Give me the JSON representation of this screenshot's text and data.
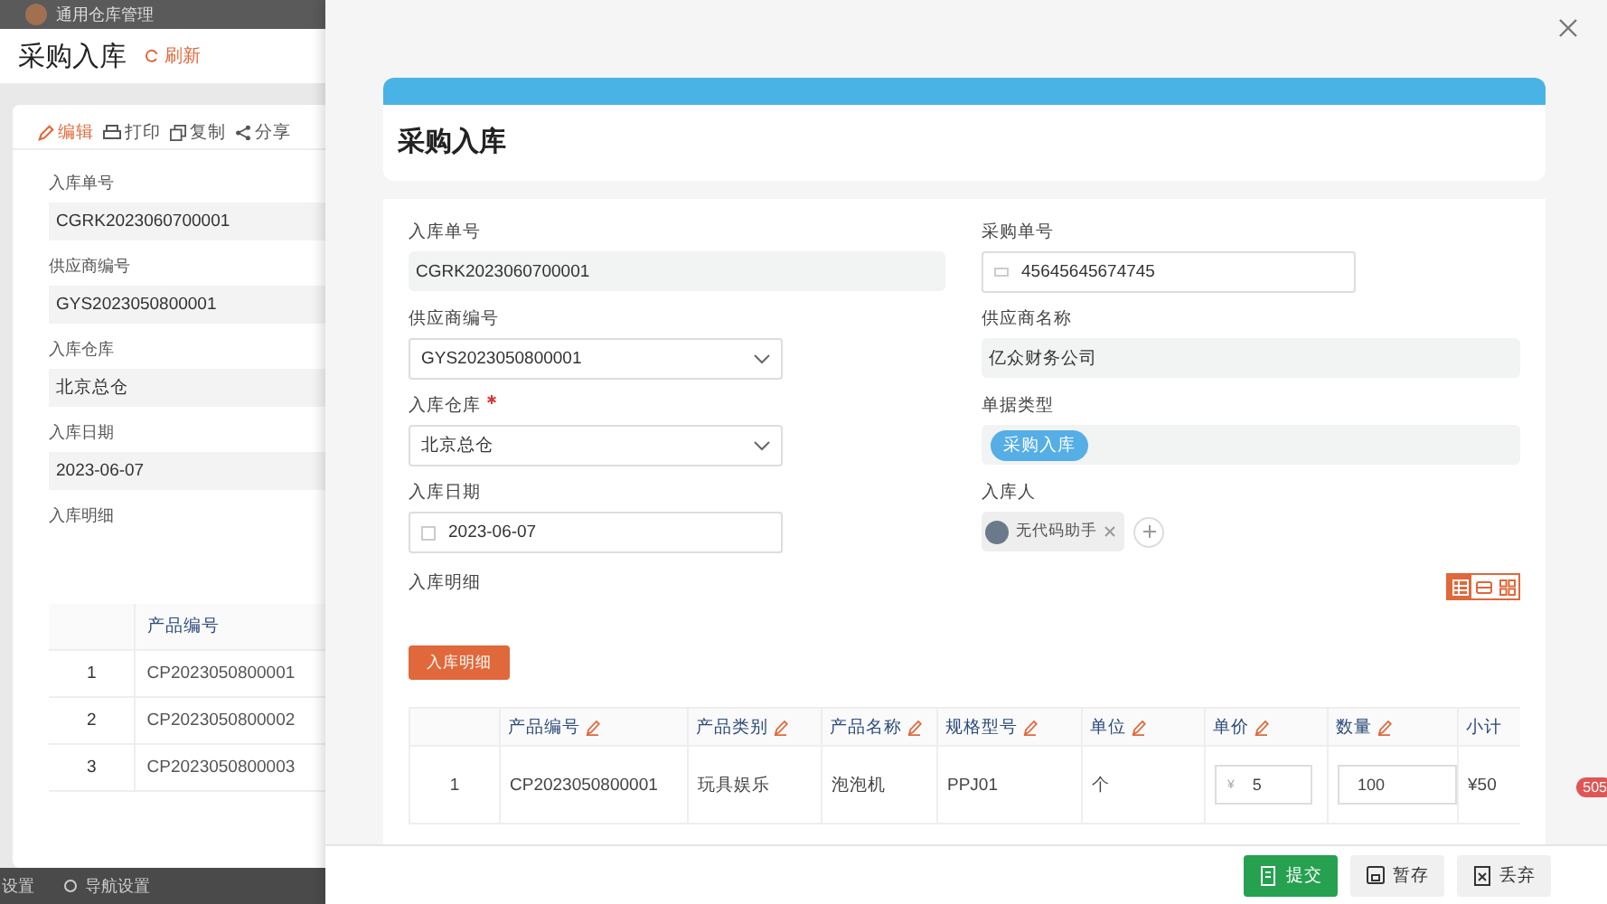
{
  "background_page": {
    "app_name": "通用仓库管理",
    "title": "采购入库",
    "refresh": "刷新",
    "toolbar": [
      {
        "label": "编辑",
        "kind": "edit",
        "primary": true
      },
      {
        "label": "打印",
        "kind": "print",
        "primary": false
      },
      {
        "label": "复制",
        "kind": "copy",
        "primary": false
      },
      {
        "label": "分享",
        "kind": "share",
        "primary": false
      }
    ],
    "fields": [
      {
        "label": "入库单号",
        "value": "CGRK2023060700001"
      },
      {
        "label": "供应商编号",
        "value": "GYS2023050800001"
      },
      {
        "label": "入库仓库",
        "value": "北京总仓"
      },
      {
        "label": "入库日期",
        "value": "2023-06-07"
      }
    ],
    "detail_label": "入库明细",
    "table": {
      "columns": [
        "",
        "产品编号"
      ],
      "rows": [
        [
          "1",
          "CP2023050800001"
        ],
        [
          "2",
          "CP2023050800002"
        ],
        [
          "3",
          "CP2023050800003"
        ]
      ]
    },
    "bottom_bar": [
      "设置",
      "导航设置"
    ]
  },
  "drawer": {
    "title": "采购入库",
    "fields": [
      {
        "label": "入库单号",
        "kind": "readonly",
        "value": "CGRK2023060700001",
        "required": false
      },
      {
        "label": "采购单号",
        "kind": "input",
        "value": "45645645674745",
        "required": false
      },
      {
        "label": "供应商编号",
        "kind": "select",
        "value": "GYS2023050800001",
        "required": false
      },
      {
        "label": "供应商名称",
        "kind": "readonly",
        "value": "亿众财务公司",
        "required": false
      },
      {
        "label": "入库仓库",
        "kind": "select",
        "value": "北京总仓",
        "required": true
      },
      {
        "label": "单据类型",
        "kind": "tag",
        "value": "采购入库",
        "required": false
      },
      {
        "label": "入库日期",
        "kind": "date",
        "value": "2023-06-07",
        "required": false
      },
      {
        "label": "入库人",
        "kind": "user",
        "value": "无代码助手",
        "required": false
      }
    ],
    "detail_label": "入库明细",
    "view_modes": [
      {
        "kind": "table",
        "selected": true
      },
      {
        "kind": "card",
        "selected": false
      },
      {
        "kind": "grid",
        "selected": false
      }
    ],
    "detail_button": "入库明细",
    "table": {
      "columns": [
        {
          "label": "产品编号",
          "editable": true
        },
        {
          "label": "产品类别",
          "editable": true
        },
        {
          "label": "产品名称",
          "editable": true
        },
        {
          "label": "规格型号",
          "editable": true
        },
        {
          "label": "单位",
          "editable": true
        },
        {
          "label": "单价",
          "editable": true
        },
        {
          "label": "数量",
          "editable": true
        },
        {
          "label": "小计",
          "editable": false
        }
      ],
      "rows": [
        {
          "index": "1",
          "cells": [
            {
              "kind": "text",
              "value": "CP2023050800001"
            },
            {
              "kind": "text",
              "value": "玩具娱乐"
            },
            {
              "kind": "text",
              "value": "泡泡机"
            },
            {
              "kind": "text",
              "value": "PPJ01"
            },
            {
              "kind": "text",
              "value": "个"
            },
            {
              "kind": "price",
              "prefix": "¥",
              "value": "5"
            },
            {
              "kind": "input",
              "value": "100"
            },
            {
              "kind": "text",
              "value": "¥50"
            }
          ]
        }
      ]
    },
    "footer_buttons": [
      {
        "label": "提交",
        "kind": "submit"
      },
      {
        "label": "暂存",
        "kind": "save"
      },
      {
        "label": "丢弃",
        "kind": "discard"
      }
    ],
    "badge": "505"
  }
}
